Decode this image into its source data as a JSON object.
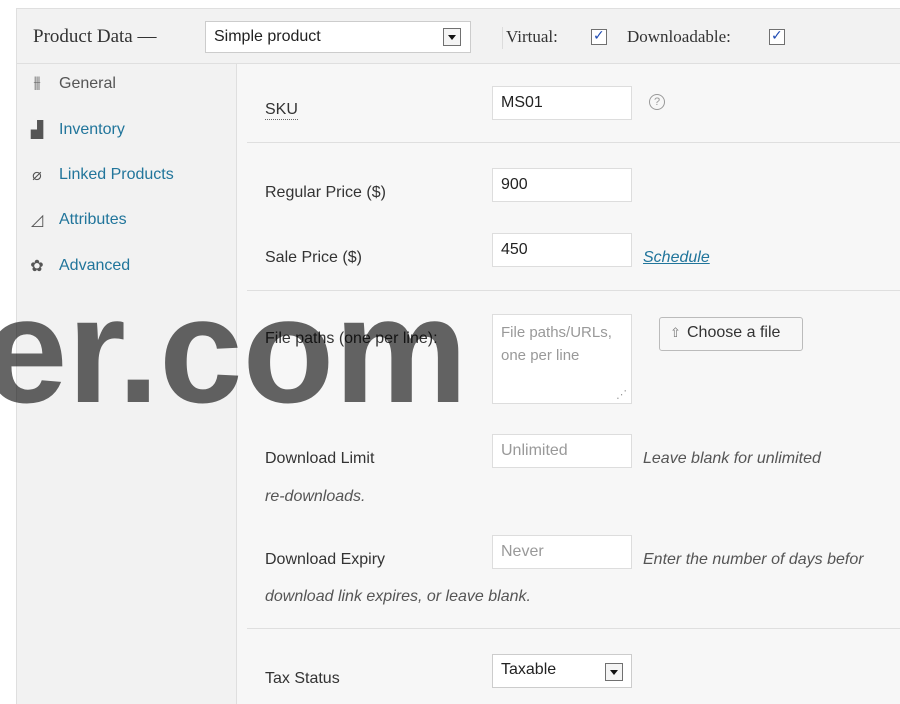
{
  "header": {
    "title": "Product Data —",
    "product_type": "Simple product",
    "virtual_label": "Virtual:",
    "virtual_checked": true,
    "downloadable_label": "Downloadable:",
    "downloadable_checked": true
  },
  "sidebar": {
    "items": [
      {
        "label": "General",
        "icon": "sliders-icon",
        "active": true
      },
      {
        "label": "Inventory",
        "icon": "inventory-icon",
        "active": false
      },
      {
        "label": "Linked Products",
        "icon": "link-icon",
        "active": false
      },
      {
        "label": "Attributes",
        "icon": "ruler-icon",
        "active": false
      },
      {
        "label": "Advanced",
        "icon": "gear-icon",
        "active": false
      }
    ]
  },
  "general": {
    "sku_label": "SKU",
    "sku_value": "MS01",
    "help_glyph": "?",
    "regular_price_label": "Regular Price ($)",
    "regular_price_value": "900",
    "sale_price_label": "Sale Price ($)",
    "sale_price_value": "450",
    "schedule_link": "Schedule",
    "file_paths_label": "File paths (one per line):",
    "file_paths_placeholder": "File paths/URLs, one per line",
    "choose_file_button": "Choose a file",
    "download_limit_label": "Download Limit",
    "download_limit_placeholder": "Unlimited",
    "download_limit_note_1": "Leave blank for unlimited",
    "download_limit_note_2": "re-downloads.",
    "download_expiry_label": "Download Expiry",
    "download_expiry_placeholder": "Never",
    "download_expiry_note_1": "Enter the number of days befor",
    "download_expiry_note_2": "download link expires, or leave blank.",
    "tax_status_label": "Tax Status",
    "tax_status_value": "Taxable"
  },
  "watermark": "er.com"
}
